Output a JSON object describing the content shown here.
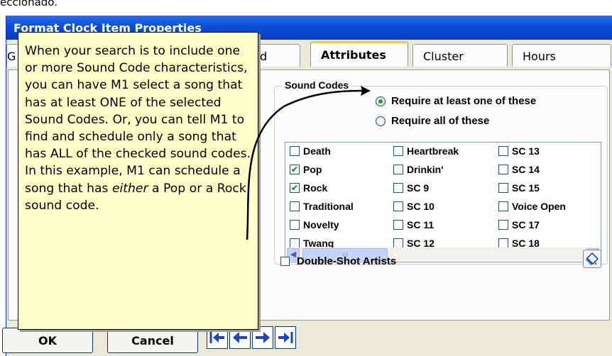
{
  "caption_fragment": "eccionado.",
  "window": {
    "title": "Format Clock Item Properties"
  },
  "tabs": {
    "first_initial": "G",
    "partial": "and",
    "attributes": "Attributes",
    "cluster": "Cluster",
    "hours": "Hours"
  },
  "sound_codes": {
    "title": "Sound Codes",
    "options": [
      {
        "label": "Require at least one of these",
        "selected": true
      },
      {
        "label": "Require all of these",
        "selected": false
      }
    ],
    "items": [
      {
        "label": "Death",
        "checked": false
      },
      {
        "label": "Pop",
        "checked": true
      },
      {
        "label": "Rock",
        "checked": true
      },
      {
        "label": "Traditional",
        "checked": false
      },
      {
        "label": "Novelty",
        "checked": false
      },
      {
        "label": "Twang",
        "checked": false
      },
      {
        "label": "Heartbreak",
        "checked": false
      },
      {
        "label": "Drinkin'",
        "checked": false
      },
      {
        "label": "SC 9",
        "checked": false
      },
      {
        "label": "SC 10",
        "checked": false
      },
      {
        "label": "SC 11",
        "checked": false
      },
      {
        "label": "SC 12",
        "checked": false
      },
      {
        "label": "SC 13",
        "checked": false
      },
      {
        "label": "SC 14",
        "checked": false
      },
      {
        "label": "SC 15",
        "checked": false
      },
      {
        "label": "Voice Open",
        "checked": false
      },
      {
        "label": "SC 17",
        "checked": false
      },
      {
        "label": "SC 18",
        "checked": false
      }
    ],
    "scroll_thumb_grip": "III"
  },
  "double_shot": {
    "label": "Double-Shot Artists",
    "checked": false
  },
  "buttons": {
    "ok": "OK",
    "cancel": "Cancel"
  },
  "nav_icons": [
    "first-page-icon",
    "previous-icon",
    "next-icon",
    "last-page-icon"
  ],
  "callout": {
    "part1": "When your search is to include one or more Sound Code characteristics, you can have M1 select a song that has at least ONE of the selected Sound Codes.  Or, you can tell M1 to find and schedule only a song that has ALL of the checked sound codes.  In this example, M1 can schedule a song that has ",
    "emphasis": "either",
    "part2": " a Pop or a Rock sound code."
  },
  "colors": {
    "titlebar": "#0a4fd6",
    "callout_bg": "#ffffc8",
    "checkmark": "#21a121",
    "nav_arrow": "#1b44c8"
  }
}
